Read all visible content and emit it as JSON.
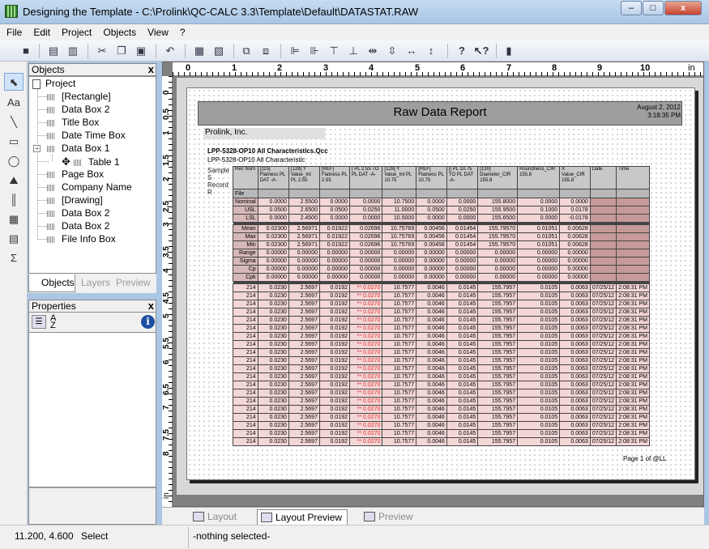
{
  "window": {
    "title": "Designing the Template - C:\\Prolink\\QC-CALC 3.3\\Template\\Default\\DATASTAT.RAW",
    "minimize": "–",
    "maximize": "□",
    "close": "x"
  },
  "menu": [
    "File",
    "Edit",
    "Project",
    "Objects",
    "View",
    "?"
  ],
  "objects_panel": {
    "header": "Objects",
    "close": "x",
    "tree": [
      "Project",
      "[Rectangle]",
      "Data Box 2",
      "Title Box",
      "Date Time Box",
      "Data Box 1",
      "Table 1",
      "Page Box",
      "Company Name",
      "[Drawing]",
      "Data Box 2",
      "Data Box 2",
      "File Info Box"
    ],
    "tabs": [
      "Objects",
      "Layers",
      "Preview"
    ]
  },
  "properties_panel": {
    "header": "Properties",
    "close": "x",
    "info_icon": "i"
  },
  "ruler": {
    "h": [
      "0",
      "1",
      "2",
      "3",
      "4",
      "5",
      "6",
      "7",
      "8",
      "9",
      "10",
      "in"
    ],
    "v": [
      "0",
      "0.5",
      "1",
      "1.5",
      "2",
      "2.5",
      "3",
      "3.5",
      "4",
      "4.5",
      "5",
      "5.5",
      "6",
      "6.5",
      "7",
      "7.5",
      "8",
      "in"
    ]
  },
  "report": {
    "title": "Raw Data Report",
    "date": "August 2, 2012",
    "time": "3:18:35 PM",
    "company": "Prolink, Inc.",
    "desc1": "LPP-5328-OP10 All Characteristics.Qcc",
    "desc2": "LPP-5328-OP10 All Characteristic",
    "sample_label": "Sample S Record R",
    "columns": [
      "Rec Num",
      "[115] Flatness PL DAT -A-",
      "[128] Y Value_Int PL 2.55",
      "[REF] Flatness PL 2.55",
      "| PL 2.55 TO PL DAT -A-",
      "[128] Y Value_Int PL 10.75",
      "[REF] Flatness PL 10.75",
      "|| PL 10.75 TO PL DAT -A-",
      "[130] Diameter_CIR 155.8",
      "Roundness_CIR 155.8",
      "X Value_CIR 155.8",
      "Date",
      "Time"
    ],
    "file_label": "File",
    "spec_rows": [
      {
        "label": "Nominal",
        "values": [
          "0.0000",
          "2.5500",
          "0.0000",
          "0.0000",
          "10.7500",
          "0.0000",
          "0.0000",
          "155.8000",
          "0.0000",
          "0.0000"
        ]
      },
      {
        "label": "USL",
        "values": [
          "0.0500",
          "2.6500",
          "0.0500",
          "0.0250",
          "11.0000",
          "0.0500",
          "0.0250",
          "155.9500",
          "0.1000",
          "0.0178"
        ]
      },
      {
        "label": "LSL",
        "values": [
          "0.0000",
          "2.4500",
          "0.0000",
          "0.0000",
          "10.5000",
          "0.0000",
          "0.0000",
          "155.6500",
          "0.0000",
          "-0.0178"
        ]
      }
    ],
    "stat_rows": [
      {
        "label": "Mean",
        "values": [
          "0.02300",
          "2.56971",
          "0.01922",
          "0.02696",
          "10.75769",
          "0.00456",
          "0.01454",
          "155.79570",
          "0.01051",
          "0.00628"
        ]
      },
      {
        "label": "Max",
        "values": [
          "0.02300",
          "2.56971",
          "0.01922",
          "0.02696",
          "10.75769",
          "0.00456",
          "0.01454",
          "155.79570",
          "0.01051",
          "0.00628"
        ]
      },
      {
        "label": "Min",
        "values": [
          "0.02300",
          "2.56971",
          "0.01922",
          "0.02696",
          "10.75769",
          "0.00456",
          "0.01454",
          "155.79570",
          "0.01051",
          "0.00628"
        ]
      },
      {
        "label": "Range",
        "values": [
          "0.00000",
          "0.00000",
          "0.00000",
          "0.00000",
          "0.00000",
          "0.00000",
          "0.00000",
          "0.00000",
          "0.00000",
          "0.00000"
        ]
      },
      {
        "label": "Sigma",
        "values": [
          "0.00000",
          "0.00000",
          "0.00000",
          "0.00000",
          "0.00000",
          "0.00000",
          "0.00000",
          "0.00000",
          "0.00000",
          "0.00000"
        ]
      },
      {
        "label": "Cp",
        "values": [
          "0.00000",
          "0.00000",
          "0.00000",
          "0.00000",
          "0.00000",
          "0.00000",
          "0.00000",
          "0.00000",
          "0.00000",
          "0.00000"
        ]
      },
      {
        "label": "Cpk",
        "values": [
          "0.00000",
          "0.00000",
          "0.00000",
          "0.00000",
          "0.00000",
          "0.00000",
          "0.00000",
          "0.00000",
          "0.00000",
          "0.00000"
        ]
      }
    ],
    "data_row": {
      "rec": "214",
      "values": [
        "0.0230",
        "2.5697",
        "0.0192",
        "** 0.0270",
        "10.7577",
        "0.0046",
        "0.0145",
        "155.7957",
        "0.0105",
        "0.0063",
        "07/25/12",
        "2:08:31 PM"
      ]
    },
    "data_row_count": 20,
    "page_footer": "Page 1 of  @LL"
  },
  "bottom_tabs": [
    "Layout",
    "Layout Preview",
    "Preview"
  ],
  "status": {
    "coords": "11.200, 4.600",
    "mode": "Select",
    "selection": "-nothing selected-"
  }
}
